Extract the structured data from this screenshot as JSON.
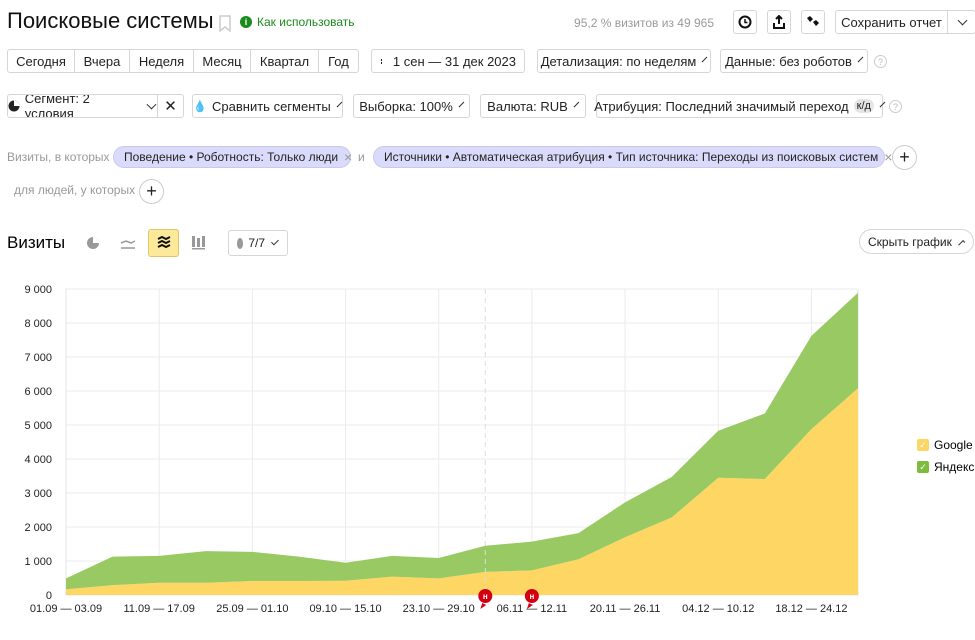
{
  "header": {
    "title": "Поисковые системы",
    "help_link": "Как использовать",
    "visits_summary": "95,2 % визитов из 49 965",
    "save_label": "Сохранить отчет"
  },
  "period": {
    "buttons": [
      "Сегодня",
      "Вчера",
      "Неделя",
      "Месяц",
      "Квартал",
      "Год"
    ],
    "date_range": "1 сен — 31 дек 2023",
    "detail": "Детализация: по неделям",
    "data": "Данные: без роботов"
  },
  "filters": {
    "segment": "Сегмент: 2 условия",
    "compare": "Сравнить сегменты",
    "sample": "Выборка: 100%",
    "currency": "Валюта: RUB",
    "attribution": "Атрибуция: Последний значимый переход",
    "attribution_badge": "к/д"
  },
  "conditions": {
    "visits_label": "Визиты, в которых",
    "chip1": "Поведение • Роботность: Только люди",
    "and": "и",
    "chip2": "Источники • Автоматическая атрибуция • Тип источника: Переходы из поисковых систем",
    "people_label": "для людей, у которых"
  },
  "chart_toolbar": {
    "title": "Визиты",
    "comments": "7/7",
    "hide_chart": "Скрыть график",
    "active_view": "stacked-area"
  },
  "colors": {
    "google": "#fdd663",
    "yandex": "#98c963",
    "accent": "#fde99a",
    "help_green": "#1b8b1b",
    "annotation": "#d40012"
  },
  "chart_data": {
    "type": "area",
    "stacked": true,
    "categories": [
      "01.09 — 03.09",
      "04.09 — 10.09",
      "11.09 — 17.09",
      "18.09 — 24.09",
      "25.09 — 01.10",
      "02.10 — 08.10",
      "09.10 — 15.10",
      "16.10 — 22.10",
      "23.10 — 29.10",
      "30.10 — 05.11",
      "06.11 — 12.11",
      "13.11 — 19.11",
      "20.11 — 26.11",
      "27.11 — 03.12",
      "04.12 — 10.12",
      "11.12 — 17.12",
      "18.12 — 24.12",
      "25.12 — 31.12"
    ],
    "tick_labels": [
      "01.09 — 03.09",
      "11.09 — 17.09",
      "25.09 — 01.10",
      "09.10 — 15.10",
      "23.10 — 29.10",
      "06.11 — 12.11",
      "20.11 — 26.11",
      "04.12 — 10.12",
      "18.12 — 24.12"
    ],
    "series": [
      {
        "name": "Google",
        "color": "#fdd663",
        "values": [
          170,
          290,
          360,
          360,
          410,
          410,
          420,
          540,
          490,
          680,
          725,
          1050,
          1700,
          2280,
          3450,
          3410,
          4880,
          6080
        ]
      },
      {
        "name": "Яндекс",
        "color": "#98c963",
        "values": [
          320,
          840,
          790,
          930,
          860,
          720,
          530,
          610,
          600,
          770,
          845,
          770,
          1025,
          1190,
          1380,
          1930,
          2740,
          2810
        ]
      }
    ],
    "ylim": [
      0,
      9000
    ],
    "yticks": [
      "0",
      "1 000",
      "2 000",
      "3 000",
      "4 000",
      "5 000",
      "6 000",
      "7 000",
      "8 000",
      "9 000"
    ],
    "grid": true,
    "legend": "right",
    "annotations": [
      {
        "category": "30.10 — 05.11",
        "label": "н"
      },
      {
        "category": "06.11 — 12.11",
        "label": "н"
      }
    ]
  }
}
